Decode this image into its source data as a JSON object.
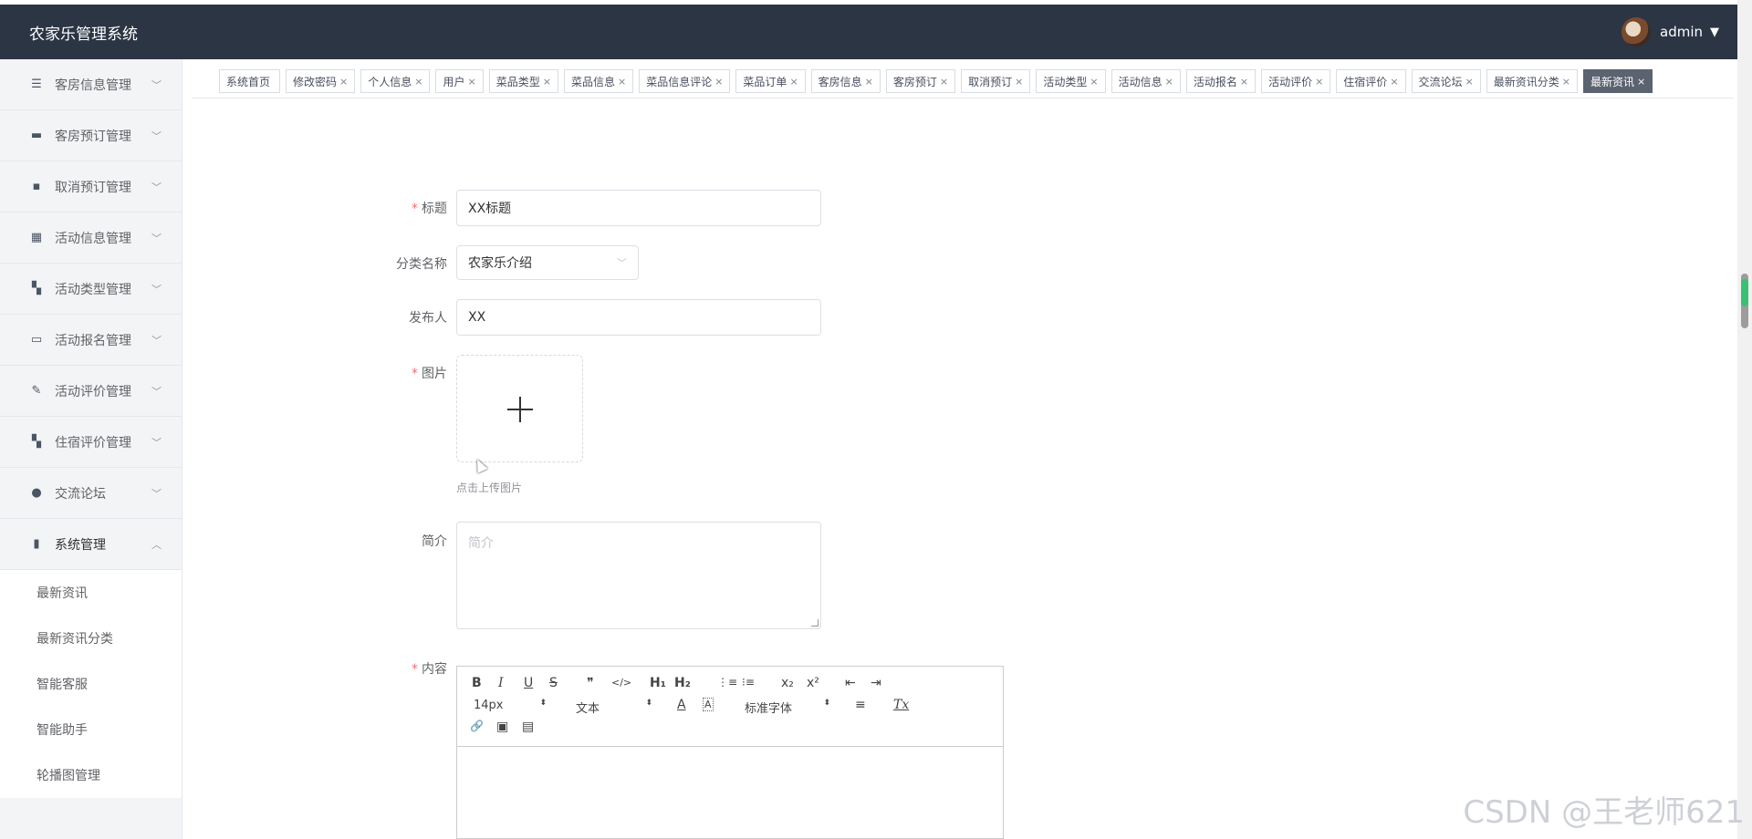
{
  "header": {
    "app_title": "农家乐管理系统",
    "username": "admin",
    "caret": "▼"
  },
  "sidebar": {
    "items": [
      {
        "label": "客房信息管理",
        "icon": "☰",
        "icon_name": "list-icon",
        "chevron": "﹀"
      },
      {
        "label": "客房预订管理",
        "icon": "▬",
        "icon_name": "monitor-icon",
        "chevron": "﹀"
      },
      {
        "label": "取消预订管理",
        "icon": "▪",
        "icon_name": "message-icon",
        "chevron": "﹀"
      },
      {
        "label": "活动信息管理",
        "icon": "▦",
        "icon_name": "grid-icon",
        "chevron": "﹀"
      },
      {
        "label": "活动类型管理",
        "icon": "▚",
        "icon_name": "apps-icon",
        "chevron": "﹀"
      },
      {
        "label": "活动报名管理",
        "icon": "▭",
        "icon_name": "cart-icon",
        "chevron": "﹀"
      },
      {
        "label": "活动评价管理",
        "icon": "✎",
        "icon_name": "clipboard-icon",
        "chevron": "﹀"
      },
      {
        "label": "住宿评价管理",
        "icon": "▚",
        "icon_name": "apps-icon",
        "chevron": "﹀"
      },
      {
        "label": "交流论坛",
        "icon": "●",
        "icon_name": "bulb-icon",
        "chevron": "﹀"
      },
      {
        "label": "系统管理",
        "icon": "▮",
        "icon_name": "bar-chart-icon",
        "chevron": "︿"
      }
    ],
    "sub_items": [
      "最新资讯",
      "最新资讯分类",
      "智能客服",
      "智能助手",
      "轮播图管理"
    ]
  },
  "tags": [
    {
      "label": "系统首页",
      "close": ""
    },
    {
      "label": "修改密码",
      "close": "×"
    },
    {
      "label": "个人信息",
      "close": "×"
    },
    {
      "label": "用户",
      "close": "×"
    },
    {
      "label": "菜品类型",
      "close": "×"
    },
    {
      "label": "菜品信息",
      "close": "×"
    },
    {
      "label": "菜品信息评论",
      "close": "×"
    },
    {
      "label": "菜品订单",
      "close": "×"
    },
    {
      "label": "客房信息",
      "close": "×"
    },
    {
      "label": "客房预订",
      "close": "×"
    },
    {
      "label": "取消预订",
      "close": "×"
    },
    {
      "label": "活动类型",
      "close": "×"
    },
    {
      "label": "活动信息",
      "close": "×"
    },
    {
      "label": "活动报名",
      "close": "×"
    },
    {
      "label": "活动评价",
      "close": "×"
    },
    {
      "label": "住宿评价",
      "close": "×"
    },
    {
      "label": "交流论坛",
      "close": "×"
    },
    {
      "label": "最新资讯分类",
      "close": "×"
    },
    {
      "label": "最新资讯",
      "close": "×"
    }
  ],
  "form": {
    "required_mark": "*",
    "title_label": "标题",
    "title_value": "XX标题",
    "category_label": "分类名称",
    "category_value": "农家乐介绍",
    "select_caret": "﹀",
    "publisher_label": "发布人",
    "publisher_value": "XX",
    "image_label": "图片",
    "upload_hint": "点击上传图片",
    "intro_label": "简介",
    "intro_placeholder": "简介",
    "content_label": "内容"
  },
  "editor": {
    "font_size": "14px",
    "header_type": "文本",
    "font_family": "标准字体",
    "tools": {
      "bold": "B",
      "italic": "I",
      "underline": "U",
      "strike": "S",
      "blockquote": "❞",
      "code": "</>",
      "h1": "H₁",
      "h2": "H₂",
      "ordered_list": "⋮≡",
      "bullet_list": "⁝≡",
      "sub": "x₂",
      "sup": "x²",
      "outdent": "⇤",
      "indent": "⇥",
      "color": "A",
      "background": "A",
      "align": "≡",
      "clean": "Tx",
      "link": "🔗",
      "image": "▣",
      "video": "▤",
      "arrows": "⬍"
    }
  },
  "watermark": "CSDN @王老师621"
}
